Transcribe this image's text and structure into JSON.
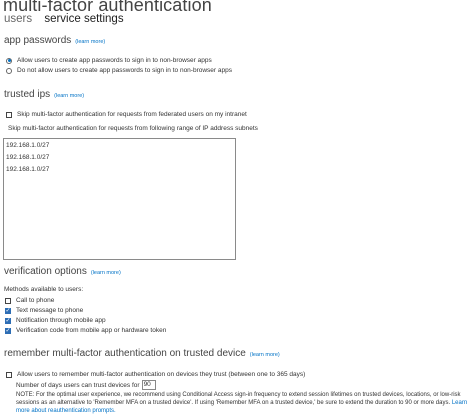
{
  "page": {
    "title": "multi-factor authentication",
    "tabs": [
      {
        "label": "users",
        "active": false
      },
      {
        "label": "service settings",
        "active": true
      }
    ]
  },
  "app_passwords": {
    "heading": "app passwords",
    "learn_more": "(learn more)",
    "options": [
      {
        "label": "Allow users to create app passwords to sign in to non-browser apps",
        "selected": true
      },
      {
        "label": "Do not allow users to create app passwords to sign in to non-browser apps",
        "selected": false
      }
    ]
  },
  "trusted_ips": {
    "heading": "trusted ips",
    "learn_more": "(learn more)",
    "skip_federated": {
      "label": "Skip multi-factor authentication for requests from federated users on my intranet",
      "checked": false
    },
    "range_label": "Skip multi-factor authentication for requests from following range of IP address subnets",
    "ips": [
      "192.168.1.0/27",
      "192.168.1.0/27",
      "192.168.1.0/27"
    ]
  },
  "verification_options": {
    "heading": "verification options",
    "learn_more": "(learn more)",
    "methods_label": "Methods available to users:",
    "methods": [
      {
        "label": "Call to phone",
        "checked": false
      },
      {
        "label": "Text message to phone",
        "checked": true
      },
      {
        "label": "Notification through mobile app",
        "checked": true
      },
      {
        "label": "Verification code from mobile app or hardware token",
        "checked": true
      }
    ]
  },
  "remember_mfa": {
    "heading": "remember multi-factor authentication on trusted device",
    "learn_more": "(learn more)",
    "allow": {
      "label": "Allow users to remember multi-factor authentication on devices they trust (between one to 365 days)",
      "checked": false
    },
    "days_label": "Number of days users can trust devices for",
    "days_value": "90",
    "note_text": "NOTE: For the optimal user experience, we recommend using Conditional Access sign-in frequency to extend session lifetimes on trusted devices, locations, or low-risk sessions as an alternative to 'Remember MFA on a trusted device'. If using 'Remember MFA on a trusted device,' be sure to extend the duration to 90 or more days.",
    "note_link": "Learn more about reauthentication prompts."
  },
  "colors": {
    "link": "#0072c6",
    "checkbox_checked": "#2d6db4"
  }
}
